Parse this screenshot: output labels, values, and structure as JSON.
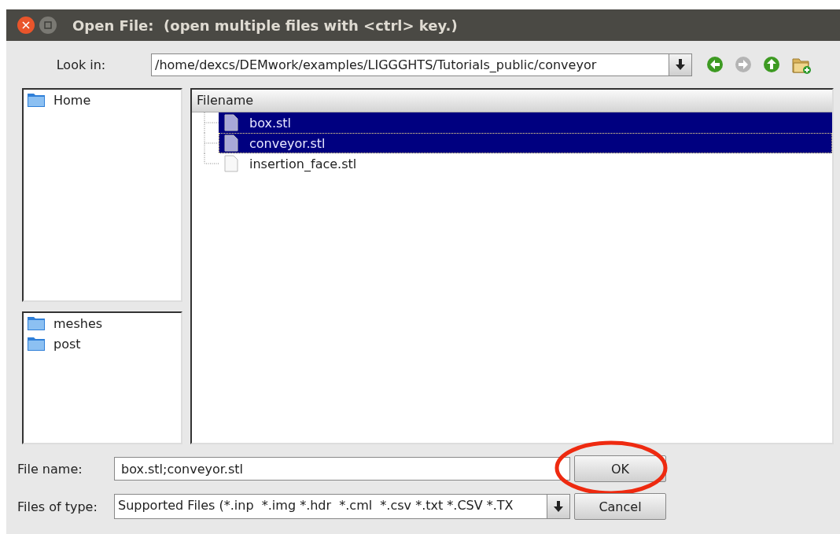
{
  "window": {
    "title": "Open File:  (open multiple files with <ctrl> key.)"
  },
  "look_in": {
    "label": "Look in:",
    "value": "/home/dexcs/DEMwork/examples/LIGGGHTS/Tutorials_public/conveyor"
  },
  "places": [
    {
      "label": "Home",
      "selected": false
    }
  ],
  "folders": [
    {
      "label": "meshes",
      "selected": false
    },
    {
      "label": "post",
      "selected": false
    }
  ],
  "file_list": {
    "column": "Filename",
    "files": [
      {
        "name": "box.stl",
        "selected": true,
        "focused": false
      },
      {
        "name": "conveyor.stl",
        "selected": true,
        "focused": true
      },
      {
        "name": "insertion_face.stl",
        "selected": false,
        "focused": false
      }
    ]
  },
  "file_name": {
    "label": "File name:",
    "value": "box.stl;conveyor.stl"
  },
  "files_of_type": {
    "label": "Files of type:",
    "value": "Supported Files (*.inp  *.img *.hdr  *.cml  *.csv *.txt *.CSV *.TX"
  },
  "buttons": [
    {
      "label": "OK",
      "highlighted": true
    },
    {
      "label": "Cancel",
      "highlighted": false
    }
  ]
}
